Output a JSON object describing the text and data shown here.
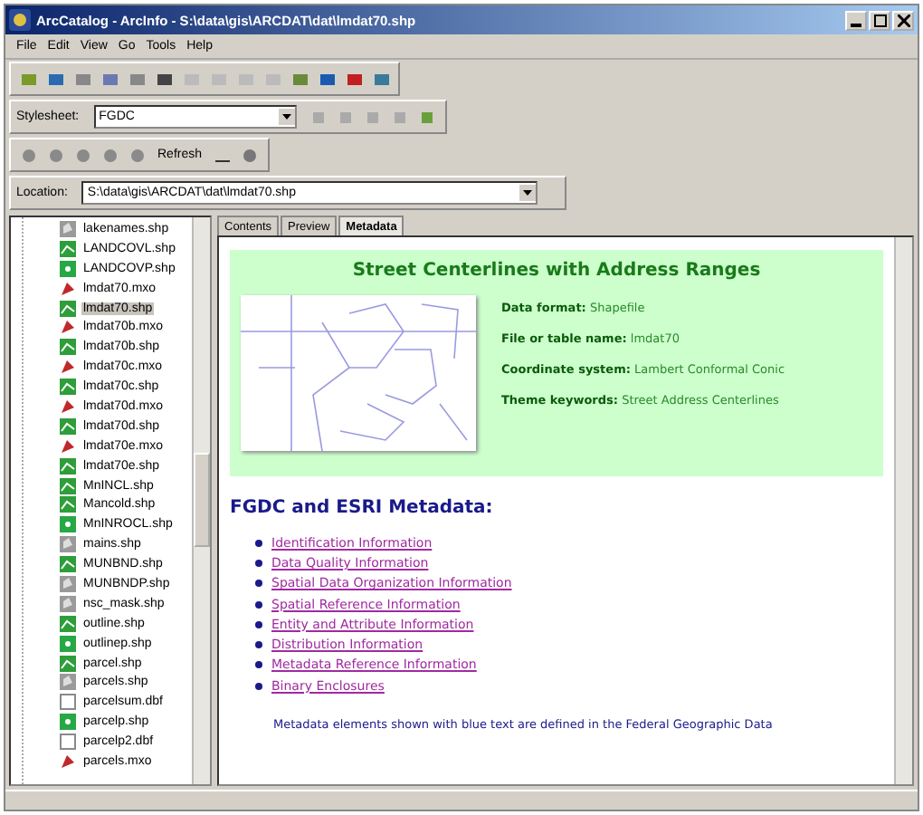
{
  "window": {
    "title": "ArcCatalog - ArcInfo - S:\\data\\gis\\ARCDAT\\dat\\lmdat70.shp"
  },
  "menu": [
    "File",
    "Edit",
    "View",
    "Go",
    "Tools",
    "Help"
  ],
  "stylesheet": {
    "label": "Stylesheet:",
    "value": "FGDC"
  },
  "refresh": {
    "label": "Refresh"
  },
  "location": {
    "label": "Location:",
    "value": "S:\\data\\gis\\ARCDAT\\dat\\lmdat70.shp"
  },
  "tree": {
    "items": [
      {
        "name": "lakenames.shp",
        "kind": "polygon",
        "selected": false
      },
      {
        "name": "LANDCOVL.shp",
        "kind": "line",
        "selected": false
      },
      {
        "name": "LANDCOVP.shp",
        "kind": "point",
        "selected": false
      },
      {
        "name": "lmdat70.mxo",
        "kind": "map",
        "selected": false
      },
      {
        "name": "lmdat70.shp",
        "kind": "line",
        "selected": true
      },
      {
        "name": "lmdat70b.mxo",
        "kind": "map",
        "selected": false
      },
      {
        "name": "lmdat70b.shp",
        "kind": "line",
        "selected": false
      },
      {
        "name": "lmdat70c.mxo",
        "kind": "map",
        "selected": false
      },
      {
        "name": "lmdat70c.shp",
        "kind": "line",
        "selected": false
      },
      {
        "name": "lmdat70d.mxo",
        "kind": "map",
        "selected": false
      },
      {
        "name": "lmdat70d.shp",
        "kind": "line",
        "selected": false
      },
      {
        "name": "lmdat70e.mxo",
        "kind": "map",
        "selected": false
      },
      {
        "name": "lmdat70e.shp",
        "kind": "line",
        "selected": false
      },
      {
        "name": "MnINCL.shp",
        "kind": "line",
        "selected": false
      },
      {
        "name": "Mancold.shp",
        "kind": "line",
        "selected": false
      },
      {
        "name": "MnINROCL.shp",
        "kind": "point",
        "selected": false
      },
      {
        "name": "mains.shp",
        "kind": "polygon",
        "selected": false
      },
      {
        "name": "MUNBND.shp",
        "kind": "line",
        "selected": false
      },
      {
        "name": "MUNBNDP.shp",
        "kind": "polygon",
        "selected": false
      },
      {
        "name": "nsc_mask.shp",
        "kind": "polygon",
        "selected": false
      },
      {
        "name": "outline.shp",
        "kind": "line",
        "selected": false
      },
      {
        "name": "outlinep.shp",
        "kind": "point",
        "selected": false
      },
      {
        "name": "parcel.shp",
        "kind": "line",
        "selected": false
      },
      {
        "name": "parcels.shp",
        "kind": "polygon",
        "selected": false
      },
      {
        "name": "parcelsum.dbf",
        "kind": "table",
        "selected": false
      },
      {
        "name": "parcelp.shp",
        "kind": "point",
        "selected": false
      },
      {
        "name": "parcelp2.dbf",
        "kind": "table",
        "selected": false
      },
      {
        "name": "parcels.mxo",
        "kind": "map",
        "selected": false
      }
    ]
  },
  "tabs": [
    {
      "label": "Contents",
      "selected": false
    },
    {
      "label": "Preview",
      "selected": false
    },
    {
      "label": "Metadata",
      "selected": true
    }
  ],
  "metadata": {
    "title": "Street Centerlines with Address Ranges",
    "fields": [
      {
        "label": "Data format:",
        "value": "Shapefile"
      },
      {
        "label": "File or table name:",
        "value": "lmdat70"
      },
      {
        "label": "Coordinate system:",
        "value": "Lambert Conformal Conic"
      },
      {
        "label": "Theme keywords:",
        "value": "Street Address Centerlines"
      }
    ],
    "heading": "FGDC and ESRI Metadata:",
    "links": [
      "Identification Information",
      "Data Quality Information",
      "Spatial Data Organization Information",
      "Spatial Reference Information",
      "Entity and Attribute Information",
      "Distribution Information",
      "Metadata Reference Information",
      "Binary Enclosures"
    ],
    "note": "Metadata elements shown with blue text are defined in the Federal Geographic Data"
  }
}
